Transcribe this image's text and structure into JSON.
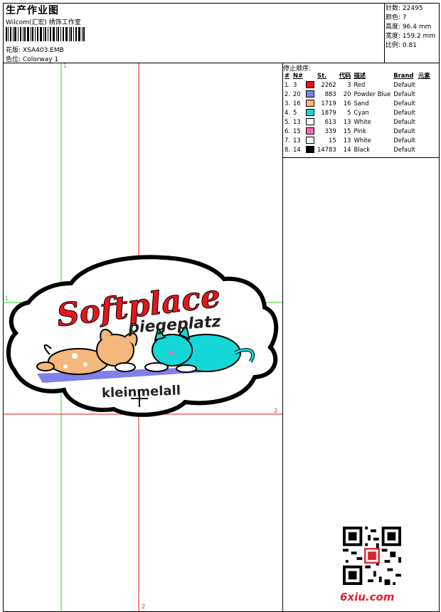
{
  "header": {
    "title": "生产作业图",
    "company": "Wilcom(汇宏) 绣饰工作室",
    "design_label": "花版:",
    "design_name": "XSA403.EMB",
    "colorway_label": "色位:",
    "colorway_name": "Colorway 1"
  },
  "stats": [
    {
      "label": "针数:",
      "value": "22495"
    },
    {
      "label": "颜色:",
      "value": "7"
    },
    {
      "label": "高度:",
      "value": "96.4 mm"
    },
    {
      "label": "宽度:",
      "value": "159.2 mm"
    },
    {
      "label": "比例:",
      "value": "0.81"
    }
  ],
  "thread_table": {
    "heading": "停止顺序:",
    "columns": [
      "#",
      "N#",
      "St.",
      "代码",
      "描述",
      "Brand",
      "元素"
    ],
    "rows": [
      {
        "idx": "1.",
        "n": "3",
        "color": "#e8141c",
        "st": "2262",
        "code": "3",
        "desc": "Red",
        "brand": "Default"
      },
      {
        "idx": "2.",
        "n": "20",
        "color": "#8080e8",
        "st": "883",
        "code": "20",
        "desc": "Powder Blue",
        "brand": "Default"
      },
      {
        "idx": "3.",
        "n": "16",
        "color": "#f4b87c",
        "st": "1719",
        "code": "16",
        "desc": "Sand",
        "brand": "Default"
      },
      {
        "idx": "4.",
        "n": "5",
        "color": "#14d8d8",
        "st": "1879",
        "code": "5",
        "desc": "Cyan",
        "brand": "Default"
      },
      {
        "idx": "5.",
        "n": "13",
        "color": "#ffffff",
        "st": "613",
        "code": "13",
        "desc": "White",
        "brand": "Default"
      },
      {
        "idx": "6.",
        "n": "15",
        "color": "#f06cb4",
        "st": "339",
        "code": "15",
        "desc": "Pink",
        "brand": "Default"
      },
      {
        "idx": "7.",
        "n": "13",
        "color": "#ffffff",
        "st": "15",
        "code": "13",
        "desc": "White",
        "brand": "Default"
      },
      {
        "idx": "8.",
        "n": "14",
        "color": "#000000",
        "st": "14783",
        "code": "14",
        "desc": "Black",
        "brand": "Default"
      }
    ]
  },
  "design": {
    "text_main": "Softplace",
    "text_sub": "piegeplatz",
    "text_bottom": "kleinmelall"
  },
  "markers": {
    "m1": "1",
    "m2": "2"
  },
  "watermark": "6xiu.com",
  "colors": {
    "guide_green": "#2bd02b",
    "guide_red": "#e01818"
  }
}
